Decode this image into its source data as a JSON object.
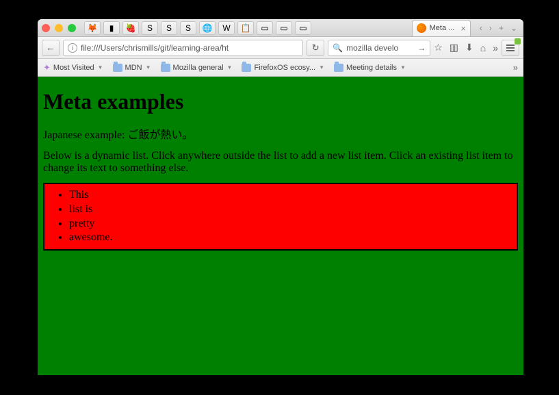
{
  "tabstrip": {
    "background_tab_icons": [
      {
        "name": "firefox-icon",
        "glyph": "🦊"
      },
      {
        "name": "pocket-icon",
        "glyph": "▮"
      },
      {
        "name": "strawberry-icon",
        "glyph": "🍓"
      },
      {
        "name": "sheets-icon-1",
        "glyph": "S"
      },
      {
        "name": "sheets-icon-2",
        "glyph": "S"
      },
      {
        "name": "sheets-icon-3",
        "glyph": "S"
      },
      {
        "name": "globe-icon",
        "glyph": "🌐"
      },
      {
        "name": "w-icon",
        "glyph": "W"
      },
      {
        "name": "clipboard-icon",
        "glyph": "📋"
      },
      {
        "name": "docs-icon",
        "glyph": "▭"
      },
      {
        "name": "bugzilla-icon",
        "glyph": "▭"
      },
      {
        "name": "generic-tab-icon",
        "glyph": "▭"
      }
    ],
    "active_tab": {
      "title": "Meta ...",
      "close": "×"
    },
    "nav_right": {
      "prev": "‹",
      "next": "›",
      "plus": "+",
      "overflow": "⌄"
    }
  },
  "navbar": {
    "back": "←",
    "info": "i",
    "url": "file:///Users/chrismills/git/learning-area/ht",
    "reload": "↻",
    "search_icon": "🔍",
    "search_text": "mozilla develo",
    "search_go": "→",
    "icons": {
      "star": "☆",
      "library": "▥",
      "download": "⬇",
      "home": "⌂",
      "overflow": "»"
    }
  },
  "bookmarks": [
    {
      "label": "Most Visited",
      "icon": "star"
    },
    {
      "label": "MDN",
      "icon": "folder"
    },
    {
      "label": "Mozilla general",
      "icon": "folder"
    },
    {
      "label": "FirefoxOS ecosy...",
      "icon": "folder"
    },
    {
      "label": "Meeting details",
      "icon": "folder"
    }
  ],
  "bookmarks_overflow": "»",
  "page": {
    "h1": "Meta examples",
    "p1": "Japanese example: ご飯が熱い。",
    "p2": "Below is a dynamic list. Click anywhere outside the list to add a new list item. Click an existing list item to change its text to something else.",
    "list": [
      "This",
      "list is",
      "pretty",
      "awesome."
    ]
  },
  "colors": {
    "page_bg": "#008000",
    "list_bg": "#ff0000",
    "list_border": "#000000"
  }
}
